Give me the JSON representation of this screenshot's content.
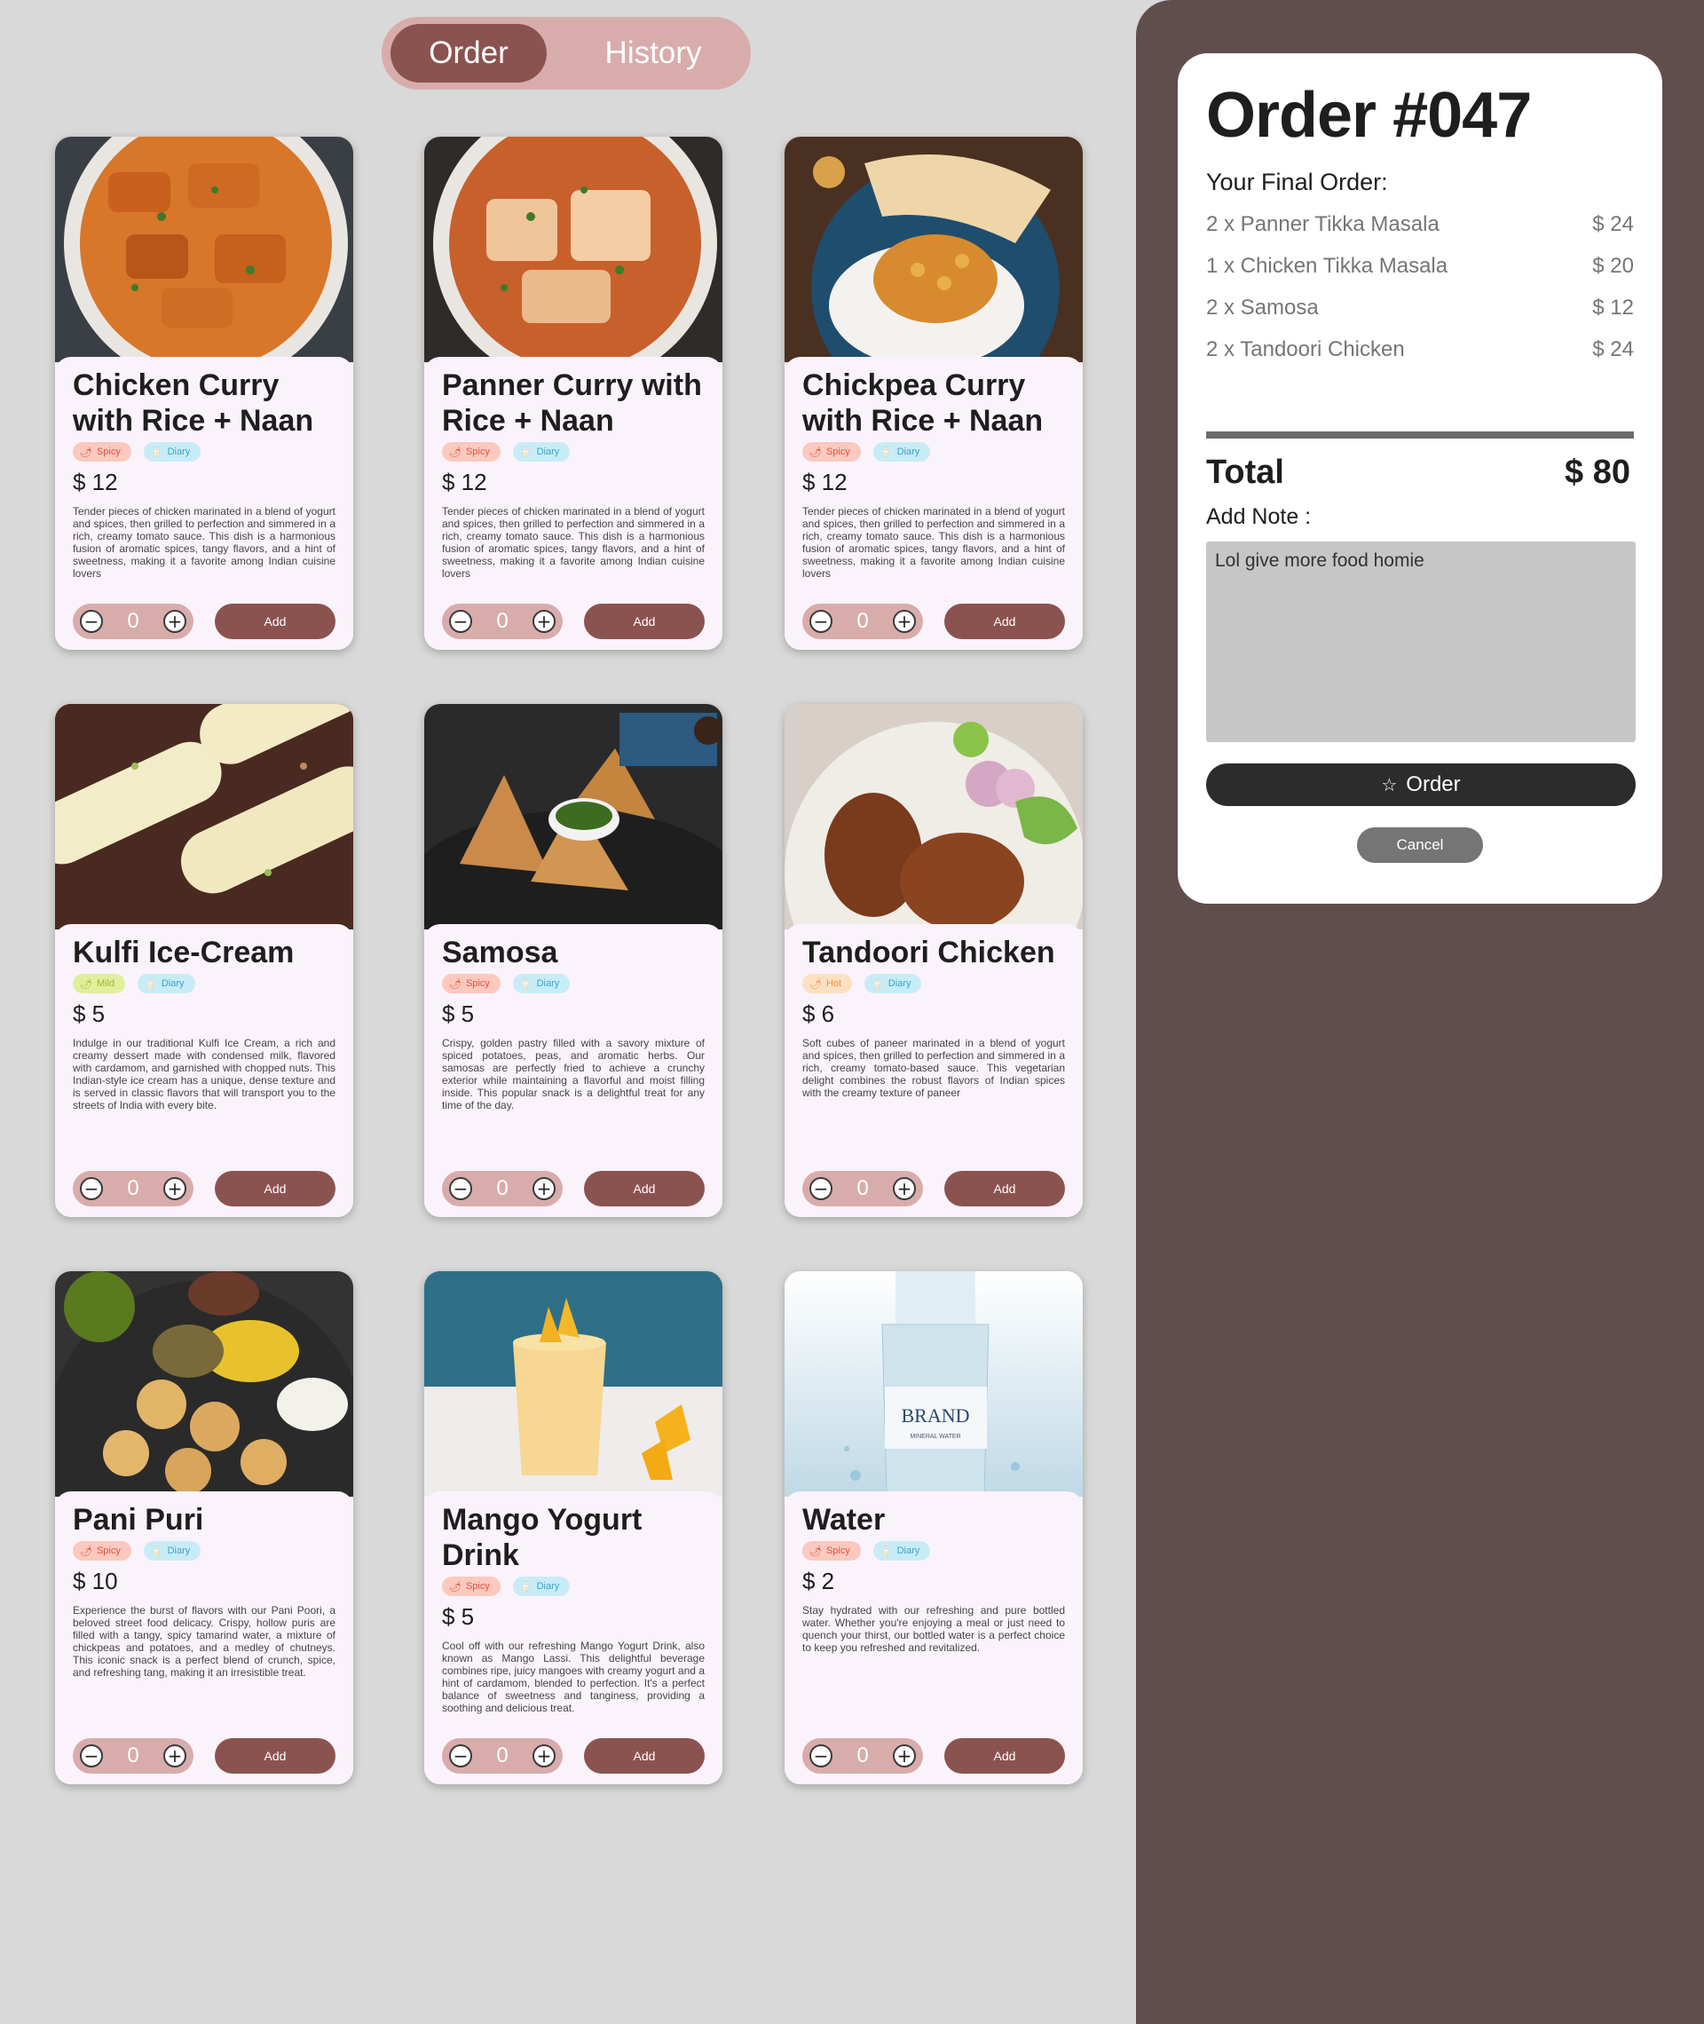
{
  "tabs": {
    "order": "Order",
    "history": "History"
  },
  "menu": [
    {
      "title": "Chicken Curry with Rice + Naan",
      "tags": [
        {
          "label": "Spicy",
          "kind": "spicy",
          "icon": "chili-icon"
        },
        {
          "label": "Diary",
          "kind": "diary",
          "icon": "milk-icon"
        }
      ],
      "price": "$ 12",
      "description": "Tender pieces of chicken marinated in a blend of yogurt and spices, then grilled to perfection and simmered in a rich, creamy tomato sauce. This dish is a harmonious fusion of aromatic spices, tangy flavors, and a hint of sweetness, making it a favorite among Indian cuisine lovers",
      "qty": "0",
      "add": "Add"
    },
    {
      "title": "Panner Curry with Rice + Naan",
      "tags": [
        {
          "label": "Spicy",
          "kind": "spicy",
          "icon": "chili-icon"
        },
        {
          "label": "Diary",
          "kind": "diary",
          "icon": "milk-icon"
        }
      ],
      "price": "$ 12",
      "description": "Tender pieces of chicken marinated in a blend of yogurt and spices, then grilled to perfection and simmered in a rich, creamy tomato sauce. This dish is a harmonious fusion of aromatic spices, tangy flavors, and a hint of sweetness, making it a favorite among Indian cuisine lovers",
      "qty": "0",
      "add": "Add"
    },
    {
      "title": "Chickpea Curry with Rice + Naan",
      "tags": [
        {
          "label": "Spicy",
          "kind": "spicy",
          "icon": "chili-icon"
        },
        {
          "label": "Diary",
          "kind": "diary",
          "icon": "milk-icon"
        }
      ],
      "price": "$ 12",
      "description": "Tender pieces of chicken marinated in a blend of yogurt and spices, then grilled to perfection and simmered in a rich, creamy tomato sauce. This dish is a harmonious fusion of aromatic spices, tangy flavors, and a hint of sweetness, making it a favorite among Indian cuisine lovers",
      "qty": "0",
      "add": "Add"
    },
    {
      "title": "Kulfi Ice-Cream",
      "tags": [
        {
          "label": "Mild",
          "kind": "mild",
          "icon": "chili-icon"
        },
        {
          "label": "Diary",
          "kind": "diary",
          "icon": "milk-icon"
        }
      ],
      "price": "$ 5",
      "description": "Indulge in our traditional Kulfi Ice Cream, a rich and creamy dessert made with condensed milk, flavored with cardamom, and garnished with chopped nuts. This Indian-style ice cream has a unique, dense texture and is served in classic flavors that will transport you to the streets of India with every bite.",
      "qty": "0",
      "add": "Add"
    },
    {
      "title": "Samosa",
      "tags": [
        {
          "label": "Spicy",
          "kind": "spicy",
          "icon": "chili-icon"
        },
        {
          "label": "Diary",
          "kind": "diary",
          "icon": "milk-icon"
        }
      ],
      "price": "$ 5",
      "description": "Crispy, golden pastry filled with a savory mixture of spiced potatoes, peas, and aromatic herbs. Our samosas are perfectly fried to achieve a crunchy exterior while maintaining a flavorful and moist filling inside. This popular snack is a delightful treat for any time of the day.",
      "qty": "0",
      "add": "Add"
    },
    {
      "title": "Tandoori Chicken",
      "tags": [
        {
          "label": "Hot",
          "kind": "hot",
          "icon": "chili-icon"
        },
        {
          "label": "Diary",
          "kind": "diary",
          "icon": "milk-icon"
        }
      ],
      "price": "$ 6",
      "description": "Soft cubes of paneer marinated in a blend of yogurt and spices, then grilled to perfection and simmered in a rich, creamy tomato-based sauce. This vegetarian delight combines the robust flavors of Indian spices with the creamy texture of paneer",
      "qty": "0",
      "add": "Add"
    },
    {
      "title": "Pani Puri",
      "tags": [
        {
          "label": "Spicy",
          "kind": "spicy",
          "icon": "chili-icon"
        },
        {
          "label": "Diary",
          "kind": "diary",
          "icon": "milk-icon"
        }
      ],
      "price": "$ 10",
      "description": "Experience the burst of flavors with our Pani Poori, a beloved street food delicacy. Crispy, hollow puris are filled with a tangy, spicy tamarind water, a mixture of chickpeas and potatoes, and a medley of chutneys. This iconic snack is a perfect blend of crunch, spice, and refreshing tang, making it an irresistible treat.",
      "qty": "0",
      "add": "Add"
    },
    {
      "title": "Mango Yogurt Drink",
      "tags": [
        {
          "label": "Spicy",
          "kind": "spicy",
          "icon": "chili-icon"
        },
        {
          "label": "Diary",
          "kind": "diary",
          "icon": "milk-icon"
        }
      ],
      "price": "$ 5",
      "description": "Cool off with our refreshing Mango Yogurt Drink, also known as Mango Lassi. This delightful beverage combines ripe, juicy mangoes with creamy yogurt and a hint of cardamom, blended to perfection. It's a perfect balance of sweetness and tanginess, providing a soothing and delicious treat.",
      "qty": "0",
      "add": "Add"
    },
    {
      "title": "Water",
      "tags": [
        {
          "label": "Spicy",
          "kind": "spicy",
          "icon": "chili-icon"
        },
        {
          "label": "Diary",
          "kind": "diary",
          "icon": "milk-icon"
        }
      ],
      "price": "$ 2",
      "description": "Stay hydrated with our refreshing and pure bottled water. Whether you're enjoying a meal or just need to quench your thirst, our bottled water is a perfect choice to keep you refreshed and revitalized.",
      "qty": "0",
      "add": "Add"
    }
  ],
  "order": {
    "title": "Order #047",
    "final_label": "Your Final Order:",
    "items": [
      {
        "name": "2 x Panner Tikka Masala",
        "price": "$ 24"
      },
      {
        "name": "1 x Chicken Tikka Masala",
        "price": "$ 20"
      },
      {
        "name": "2 x Samosa",
        "price": "$ 12"
      },
      {
        "name": "2 x Tandoori Chicken",
        "price": "$ 24"
      }
    ],
    "total_label": "Total",
    "total_value": "$ 80",
    "note_label": "Add Note :",
    "note_value": "Lol give more food homie",
    "order_button": "Order",
    "cancel_button": "Cancel"
  },
  "bottle_brand": "BRAND",
  "bottle_sub": "MINERAL WATER"
}
